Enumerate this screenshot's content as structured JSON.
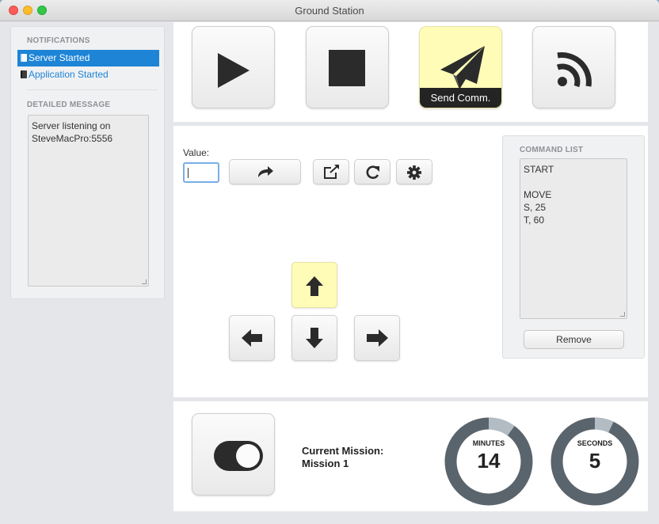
{
  "window": {
    "title": "Ground Station"
  },
  "notifications": {
    "heading": "NOTIFICATIONS",
    "items": [
      {
        "label": "Server Started",
        "selected": true
      },
      {
        "label": "Application Started",
        "selected": false
      }
    ],
    "detail_heading": "DETAILED MESSAGE",
    "detail_lines": [
      "Server listening on",
      "SteveMacPro:5556"
    ]
  },
  "toolbar": {
    "play_icon": "play-icon",
    "stop_icon": "stop-icon",
    "send_icon": "paper-plane-icon",
    "send_label": "Send Comm.",
    "feed_icon": "rss-icon"
  },
  "controls": {
    "value_label": "Value:",
    "value_input": "",
    "buttons": [
      "share-forward-icon",
      "external-link-icon",
      "refresh-icon",
      "gear-icon"
    ]
  },
  "command_list": {
    "heading": "COMMAND LIST",
    "lines": [
      "START",
      "",
      "MOVE",
      "S, 25",
      "T, 60"
    ],
    "remove_label": "Remove"
  },
  "mission": {
    "label": "Current Mission:",
    "name": "Mission 1"
  },
  "timer": {
    "minutes_label": "MINUTES",
    "minutes_value": "14",
    "minutes_fraction": 0.1,
    "seconds_label": "SECONDS",
    "seconds_value": "5",
    "seconds_fraction": 0.07
  },
  "colors": {
    "accent": "#1d84d6",
    "active_bg": "#fffcb8",
    "dark": "#242424",
    "ring_track": "#5a646c",
    "ring_elapsed": "#b3bcc3"
  }
}
